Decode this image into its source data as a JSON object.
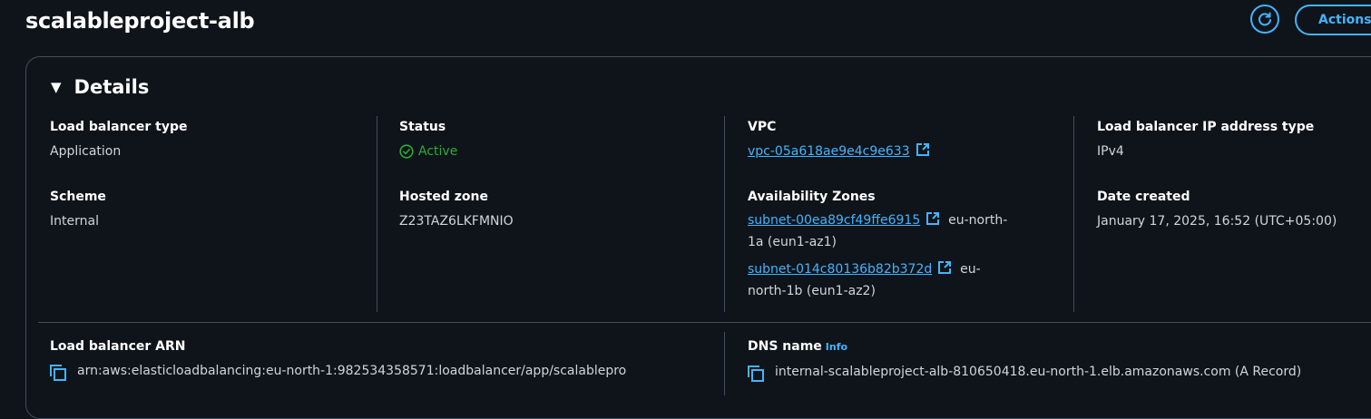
{
  "page": {
    "title": "scalableproject-alb"
  },
  "header_actions": {
    "actions_label": "Actions"
  },
  "details": {
    "heading": "Details",
    "load_balancer_type": {
      "label": "Load balancer type",
      "value": "Application"
    },
    "scheme": {
      "label": "Scheme",
      "value": "Internal"
    },
    "status": {
      "label": "Status",
      "value": "Active",
      "color": "#29ad32"
    },
    "hosted_zone": {
      "label": "Hosted zone",
      "value": "Z23TAZ6LKFMNIO"
    },
    "vpc": {
      "label": "VPC",
      "value": "vpc-05a618ae9e4c9e633"
    },
    "availability_zones": {
      "label": "Availability Zones",
      "items": [
        {
          "subnet": "subnet-00ea89cf49ffe6915",
          "zone_line1": "eu-north-",
          "zone_line2": "1a (eun1-az1)"
        },
        {
          "subnet": "subnet-014c80136b82b372d",
          "zone_line1": "eu-",
          "zone_line2": "north-1b (eun1-az2)"
        }
      ]
    },
    "ip_address_type": {
      "label": "Load balancer IP address type",
      "value": "IPv4"
    },
    "date_created": {
      "label": "Date created",
      "value": "January 17, 2025, 16:52 (UTC+05:00)"
    },
    "arn": {
      "label": "Load balancer ARN",
      "value": "arn:aws:elasticloadbalancing:eu-north-1:982534358571:loadbalancer/app/scalablepro"
    },
    "dns_name": {
      "label": "DNS name",
      "info": "Info",
      "value": "internal-scalableproject-alb-810650418.eu-north-1.elb.amazonaws.com (A Record)"
    }
  },
  "colors": {
    "background": "#0f141a",
    "accent": "#42b4ff",
    "border": "#414d5c",
    "success": "#29ad32"
  },
  "icons": [
    "refresh-icon",
    "caret-down-icon",
    "status-success-icon",
    "external-link-icon",
    "copy-icon"
  ]
}
